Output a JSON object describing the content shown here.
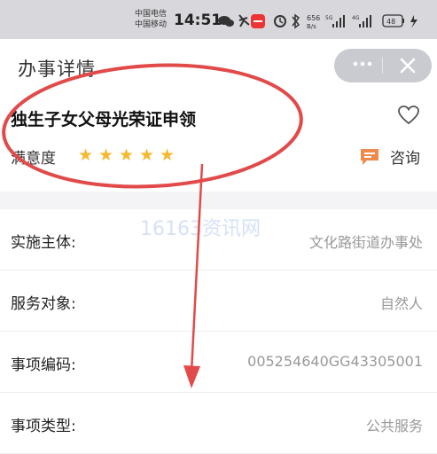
{
  "status_bar": {
    "carrier_1": "中国电信",
    "carrier_2": "中国移动",
    "time": "14:51",
    "speed_value": "656",
    "speed_unit": "B/s",
    "net_1": "5G",
    "net_2": "4G",
    "battery": "48"
  },
  "nav": {
    "title": "办事详情",
    "more_icon": "more-icon",
    "close_icon": "close-icon"
  },
  "item": {
    "title": "独生子女父母光荣证申领",
    "satisfaction_label": "满意度",
    "stars": 5,
    "consult_label": "咨询"
  },
  "watermark": "16163资讯网",
  "details": [
    {
      "label": "实施主体:",
      "value": "文化路街道办事处"
    },
    {
      "label": "服务对象:",
      "value": "自然人"
    },
    {
      "label": "事项编码:",
      "value": "005254640GG43305001"
    },
    {
      "label": "事项类型:",
      "value": "公共服务"
    }
  ],
  "colors": {
    "star": "#f5b82e",
    "consult_icon": "#f08a4b",
    "annotation_red": "#e24a4a"
  }
}
